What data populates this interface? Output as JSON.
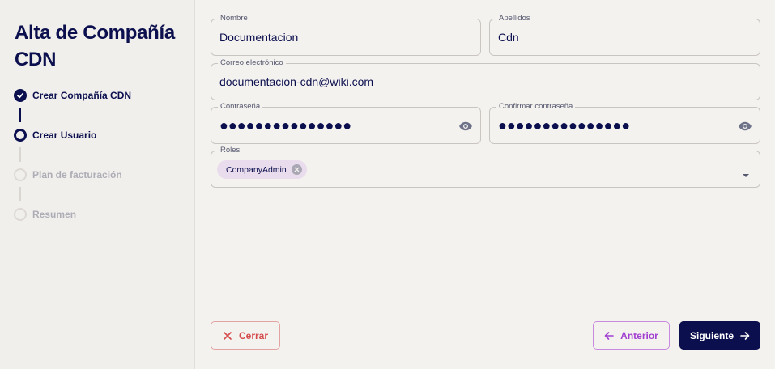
{
  "sidebar": {
    "title_line1": "Alta de Compañía",
    "title_line2": "CDN",
    "steps": [
      {
        "label": "Crear Compañía CDN",
        "status": "done"
      },
      {
        "label": "Crear Usuario",
        "status": "current"
      },
      {
        "label": "Plan de facturación",
        "status": "pending"
      },
      {
        "label": "Resumen",
        "status": "pending"
      }
    ]
  },
  "form": {
    "nombre": {
      "label": "Nombre",
      "value": "Documentacion"
    },
    "apellidos": {
      "label": "Apellidos",
      "value": "Cdn"
    },
    "correo": {
      "label": "Correo electrónico",
      "value": "documentacion-cdn@wiki.com"
    },
    "contrasena": {
      "label": "Contraseña",
      "value": "●●●●●●●●●●●●●●●"
    },
    "confirmar": {
      "label": "Confirmar contraseña",
      "value": "●●●●●●●●●●●●●●●"
    },
    "roles": {
      "label": "Roles",
      "chips": [
        "CompanyAdmin"
      ]
    }
  },
  "buttons": {
    "close": "Cerrar",
    "previous": "Anterior",
    "next": "Siguiente"
  },
  "colors": {
    "primary": "#0b0f4e",
    "danger": "#d44b4b",
    "accent": "#a13fd0",
    "chip": "#e9dcec"
  },
  "icons": {
    "step_done": "check-circle-icon",
    "password_toggle": "eye-icon",
    "chip_remove": "close-circle-icon",
    "dropdown": "caret-down-icon",
    "close": "x-icon",
    "previous": "arrow-left-icon",
    "next": "arrow-right-icon"
  }
}
